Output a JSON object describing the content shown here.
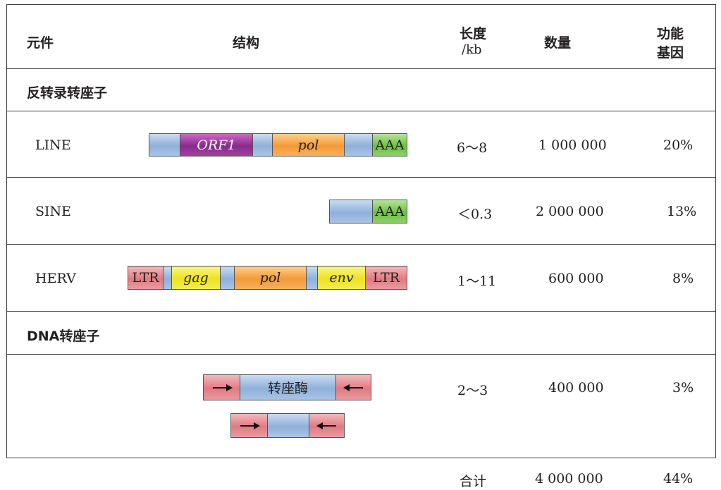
{
  "headers": {
    "element": "元件",
    "structure": "结构",
    "length_line1": "长度",
    "length_line2": "/kb",
    "count": "数量",
    "func_line1": "功能",
    "func_line2": "基因"
  },
  "sections": {
    "retrotransposon": "反转录转座子",
    "dna_transposon": "DNA转座子"
  },
  "rows": {
    "line": {
      "name": "LINE",
      "length": "6～8",
      "count": "1 000 000",
      "percent": "20%",
      "segments": {
        "orf1": "ORF1",
        "pol": "pol",
        "aaa": "AAA"
      }
    },
    "sine": {
      "name": "SINE",
      "length": "＜0.3",
      "count": "2 000 000",
      "percent": "13%",
      "segments": {
        "aaa": "AAA"
      }
    },
    "herv": {
      "name": "HERV",
      "length": "1～11",
      "count": "600 000",
      "percent": "8%",
      "segments": {
        "ltr_left": "LTR",
        "gag": "gag",
        "pol": "pol",
        "env": "env",
        "ltr_right": "LTR"
      }
    },
    "dna": {
      "name": "",
      "length": "2～3",
      "count": "400 000",
      "percent": "3%",
      "segments": {
        "transposase": "转座酶"
      }
    }
  },
  "total": {
    "label": "合计",
    "count": "4 000 000",
    "percent": "44%"
  },
  "colors": {
    "blue": "#a9c4e6",
    "purple": "#8a2a8c",
    "orange": "#f39a35",
    "green": "#6cbf44",
    "pink": "#e07a82",
    "yellow": "#eee21f"
  }
}
